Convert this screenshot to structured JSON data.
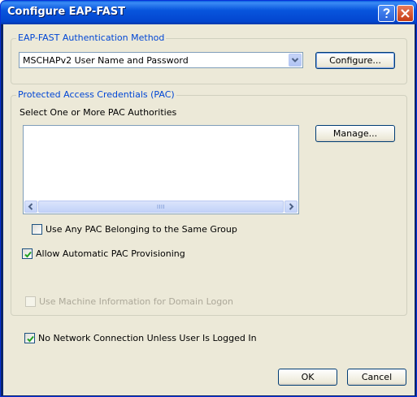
{
  "window": {
    "title": "Configure EAP-FAST",
    "help_icon": "help-icon",
    "close_icon": "close-icon"
  },
  "auth_method": {
    "group_label": "EAP-FAST Authentication Method",
    "selected": "MSCHAPv2 User Name and Password",
    "configure_label": "Configure..."
  },
  "pac": {
    "group_label": "Protected Access Credentials (PAC)",
    "select_label": "Select One or More PAC Authorities",
    "manage_label": "Manage...",
    "items": [],
    "use_any_pac": {
      "label": "Use Any PAC Belonging to the Same Group",
      "checked": false
    },
    "allow_auto_provisioning": {
      "label": "Allow Automatic PAC Provisioning",
      "checked": true
    }
  },
  "machine_info": {
    "label": "Use Machine Information for Domain Logon",
    "checked": false,
    "enabled": false
  },
  "no_network": {
    "label": "No Network Connection Unless User Is Logged In",
    "checked": true
  },
  "footer": {
    "ok_label": "OK",
    "cancel_label": "Cancel"
  }
}
